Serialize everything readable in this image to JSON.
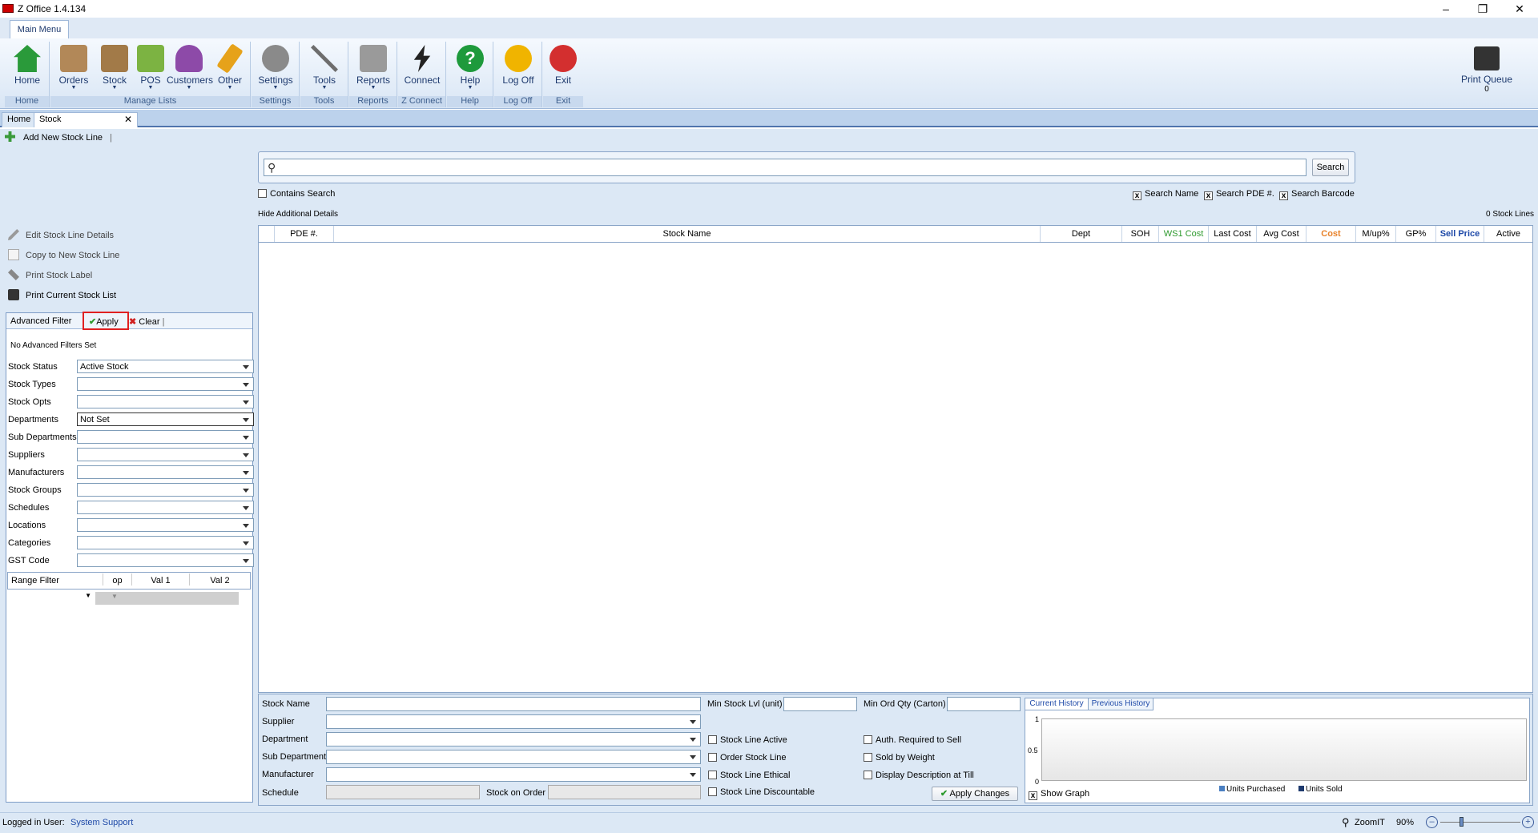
{
  "app": {
    "title": "Z Office 1.4.134"
  },
  "ribbon": {
    "tab": "Main Menu",
    "buttons": [
      {
        "label": "Home",
        "color": "#2a9a3a"
      },
      {
        "label": "Orders",
        "color": "#b28858"
      },
      {
        "label": "Stock",
        "color": "#a27a48"
      },
      {
        "label": "POS",
        "color": "#7cb342"
      },
      {
        "label": "Customers",
        "color": "#8d4aa8"
      },
      {
        "label": "Other",
        "color": "#e6a21a"
      },
      {
        "label": "Settings",
        "color": "#8a8a8a"
      },
      {
        "label": "Tools",
        "color": "#6d6d6d"
      },
      {
        "label": "Reports",
        "color": "#9a9a9a"
      },
      {
        "label": "Connect",
        "color": "#222"
      },
      {
        "label": "Help",
        "color": "#1e9a3c"
      },
      {
        "label": "Log Off",
        "color": "#f0b400"
      },
      {
        "label": "Exit",
        "color": "#d32f2f"
      }
    ],
    "groups": [
      "Home",
      "Manage Lists",
      "Settings",
      "Tools",
      "Reports",
      "Z Connect",
      "Help",
      "Log Off",
      "Exit"
    ],
    "print_queue": {
      "label": "Print Queue",
      "count": "0"
    }
  },
  "doc_tabs": [
    "Home",
    "Stock"
  ],
  "toolbar": {
    "add": "Add New Stock Line"
  },
  "search": {
    "button": "Search",
    "contains": "Contains Search",
    "opt_name": "Search Name",
    "opt_pde": "Search PDE #.",
    "opt_barcode": "Search Barcode",
    "hide_details": "Hide Additional Details",
    "count": "0 Stock Lines"
  },
  "grid": {
    "headers": [
      "PDE #.",
      "Stock Name",
      "Dept",
      "SOH",
      "WS1 Cost",
      "Last Cost",
      "Avg Cost",
      "Cost",
      "M/up%",
      "GP%",
      "Sell Price",
      "Active"
    ]
  },
  "side": {
    "edit": "Edit Stock Line Details",
    "copy": "Copy to New Stock Line",
    "label": "Print Stock Label",
    "print": "Print Current Stock List"
  },
  "filter": {
    "title": "Advanced Filter",
    "apply": "Apply",
    "clear": "Clear",
    "none": "No Advanced Filters Set",
    "rows": [
      {
        "label": "Stock Status",
        "value": "Active Stock"
      },
      {
        "label": "Stock Types",
        "value": ""
      },
      {
        "label": "Stock Opts",
        "value": ""
      },
      {
        "label": "Departments",
        "value": "Not Set"
      },
      {
        "label": "Sub Departments",
        "value": ""
      },
      {
        "label": "Suppliers",
        "value": ""
      },
      {
        "label": "Manufacturers",
        "value": ""
      },
      {
        "label": "Stock Groups",
        "value": ""
      },
      {
        "label": "Schedules",
        "value": ""
      },
      {
        "label": "Locations",
        "value": ""
      },
      {
        "label": "Categories",
        "value": ""
      },
      {
        "label": "GST Code",
        "value": ""
      }
    ],
    "range": {
      "h1": "Range Filter",
      "h2": "op",
      "h3": "Val 1",
      "h4": "Val 2"
    }
  },
  "details": {
    "stock_name": "Stock Name",
    "supplier": "Supplier",
    "department": "Department",
    "sub_department": "Sub Department",
    "manufacturer": "Manufacturer",
    "schedule": "Schedule",
    "stock_on_order": "Stock on Order",
    "min_stock": "Min Stock Lvl (unit)",
    "min_ord": "Min Ord Qty (Carton)",
    "chk_active": "Stock Line Active",
    "chk_order": "Order Stock Line",
    "chk_ethical": "Stock Line Ethical",
    "chk_discount": "Stock Line Discountable",
    "chk_auth": "Auth. Required to Sell",
    "chk_weight": "Sold by Weight",
    "chk_display": "Display Description at Till",
    "apply": "Apply Changes"
  },
  "history": {
    "tab1": "Current History",
    "tab2": "Previous History",
    "y1": "1",
    "y05": "0.5",
    "y0": "0",
    "leg1": "Units Purchased",
    "leg2": "Units Sold",
    "show_graph": "Show Graph"
  },
  "status": {
    "user_label": "Logged in User:",
    "user": "System Support",
    "zoom_label": "ZoomIT",
    "zoom": "90%"
  }
}
